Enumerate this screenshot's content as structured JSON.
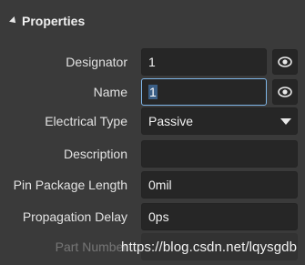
{
  "section": {
    "title": "Properties",
    "icon": "collapse-arrow-icon"
  },
  "rows": [
    {
      "label": "Designator",
      "value": "1"
    },
    {
      "label": "Name",
      "value": "1"
    },
    {
      "label": "Electrical Type",
      "value": "Passive"
    },
    {
      "label": "Description",
      "value": ""
    },
    {
      "label": "Pin Package Length",
      "value": "0mil"
    },
    {
      "label": "Propagation Delay",
      "value": "0ps"
    },
    {
      "label": "Part Number",
      "value": ""
    }
  ],
  "watermark": "https://blog.csdn.net/lqysgdb",
  "colors": {
    "background": "#3a3a3a",
    "field": "#262626",
    "focus": "#7fb6e8",
    "selection": "#3b5f86"
  }
}
